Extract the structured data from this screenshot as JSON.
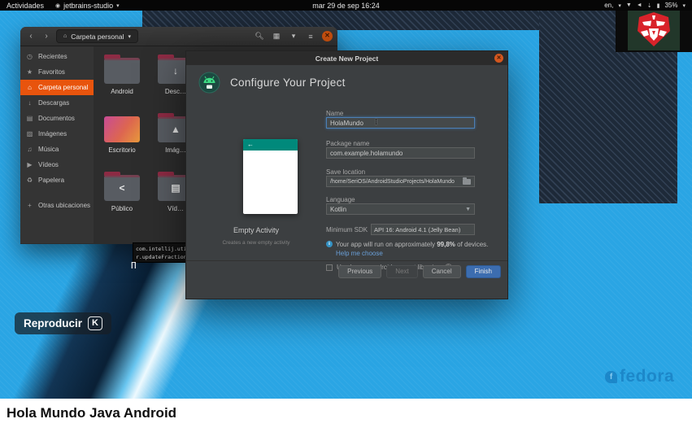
{
  "page": {
    "video_title": "Hola Mundo Java Android"
  },
  "top_bar": {
    "activities": "Actividades",
    "app_name": "jetbrains-studio",
    "clock": "mar 29 de sep 16:24",
    "input_lang": "en,",
    "battery": "35%"
  },
  "file_manager": {
    "back": "‹",
    "forward": "›",
    "path_label": "Carpeta personal",
    "sidebar": [
      {
        "glyph": "◷",
        "label": "Recientes"
      },
      {
        "glyph": "★",
        "label": "Favoritos"
      },
      {
        "glyph": "⌂",
        "label": "Carpeta personal"
      },
      {
        "glyph": "↓",
        "label": "Descargas"
      },
      {
        "glyph": "▤",
        "label": "Documentos"
      },
      {
        "glyph": "▨",
        "label": "Imágenes"
      },
      {
        "glyph": "♫",
        "label": "Música"
      },
      {
        "glyph": "▶",
        "label": "Vídeos"
      },
      {
        "glyph": "♻",
        "label": "Papelera"
      },
      {
        "glyph": "+",
        "label": "Otras ubicaciones"
      }
    ],
    "folders": [
      {
        "label": "Android",
        "glyph": ""
      },
      {
        "label": "Desc…",
        "glyph": "↓"
      },
      {
        "label": "Escritorio",
        "glyph": ""
      },
      {
        "label": "Imág…",
        "glyph": "▲"
      },
      {
        "label": "Público",
        "glyph": "<"
      },
      {
        "label": "Víd…",
        "glyph": "▤"
      }
    ]
  },
  "code_overlay": {
    "line1": "com.intellij.util",
    "line2": "r.updateFraction(",
    "caret": "Π"
  },
  "dialog": {
    "title": "Create New Project",
    "heading": "Configure Your Project",
    "template": {
      "back_arrow": "←",
      "name": "Empty Activity",
      "description": "Creates a new empty activity"
    },
    "form": {
      "name_label": "Name",
      "name_value": "HolaMundo",
      "package_label": "Package name",
      "package_value": "com.example.holamundo",
      "location_label": "Save location",
      "location_value": "/home/SeriOS/AndroidStudioProjects/HolaMundo",
      "language_label": "Language",
      "language_value": "Kotlin",
      "sdk_label": "Minimum SDK",
      "sdk_value": "API 16: Android 4.1 (Jelly Bean)",
      "info_prefix": "Your app will run on approximately ",
      "info_strong": "99,8%",
      "info_suffix": " of devices.",
      "help_link": "Help me choose",
      "legacy_label": "Use legacy android.support libraries"
    },
    "buttons": {
      "previous": "Previous",
      "next": "Next",
      "cancel": "Cancel",
      "finish": "Finish"
    }
  },
  "overlays": {
    "play_label": "Reproducir",
    "play_key": "K",
    "watermark": "fedora"
  },
  "colors": {
    "accent_orange": "#e8540d",
    "finish_blue": "#3c6db0",
    "teal": "#00897b",
    "logo_red": "#d8232a",
    "wallpaper_blue": "#2aa5e4"
  }
}
